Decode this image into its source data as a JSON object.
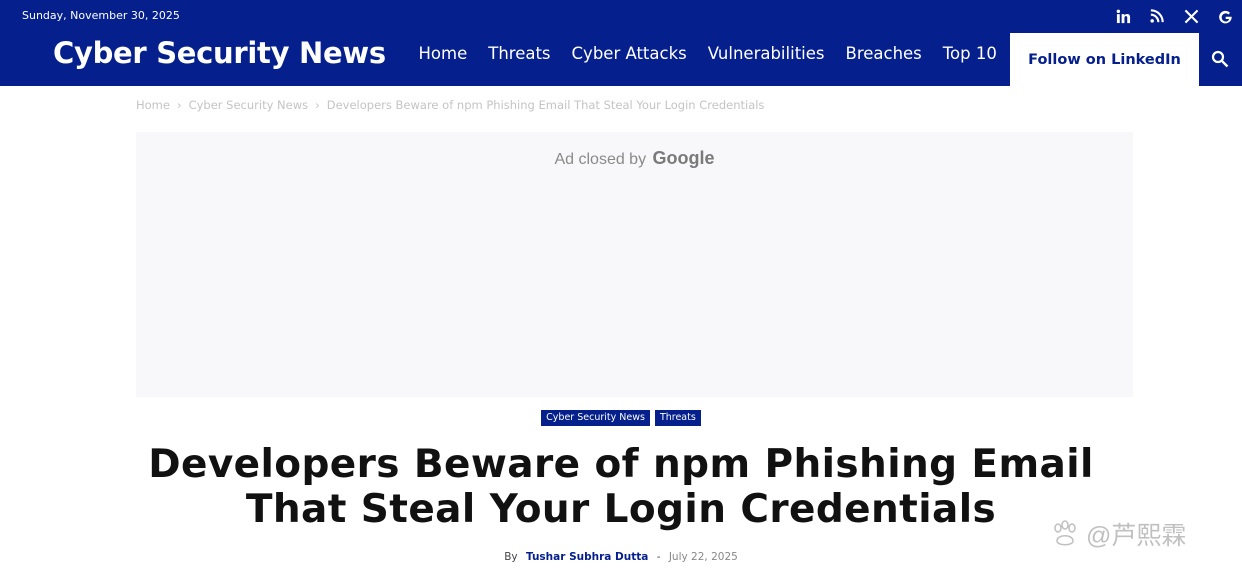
{
  "topbar": {
    "date": "Sunday, November 30, 2025"
  },
  "header": {
    "site_title": "Cyber Security News",
    "nav": [
      "Home",
      "Threats",
      "Cyber Attacks",
      "Vulnerabilities",
      "Breaches",
      "Top 10"
    ],
    "follow_label": "Follow on LinkedIn"
  },
  "social_icons": [
    "linkedin-icon",
    "rss-icon",
    "x-icon",
    "google-icon"
  ],
  "breadcrumb": [
    "Home",
    "Cyber Security News",
    "Developers Beware of npm Phishing Email That Steal Your Login Credentials"
  ],
  "ad": {
    "text": "Ad closed by",
    "brand": "Google"
  },
  "article": {
    "tags": [
      "Cyber Security News",
      "Threats"
    ],
    "title_line1": "Developers Beware of npm Phishing Email",
    "title_line2": "That Steal Your Login Credentials",
    "by": "By",
    "author": "Tushar Subhra Dutta",
    "dash": "-",
    "date": "July 22, 2025"
  },
  "watermark": {
    "handle": "@芦熙霖"
  },
  "colors": {
    "brand": "#05208c",
    "ad_bg": "#f8f8fa"
  }
}
